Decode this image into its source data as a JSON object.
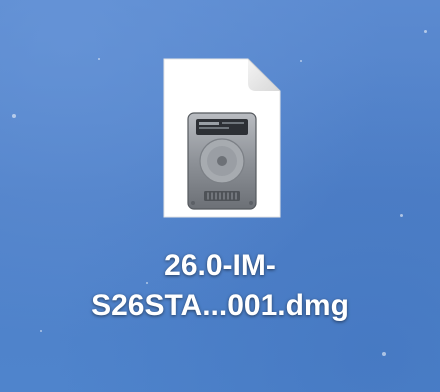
{
  "desktop": {
    "file": {
      "icon": "disk-image-document-icon",
      "name_line1": "26.0-IM-",
      "name_line2": "S26STA...001.dmg"
    }
  },
  "colors": {
    "desktop_blue": "#4f80c8",
    "label_text": "#ffffff"
  }
}
